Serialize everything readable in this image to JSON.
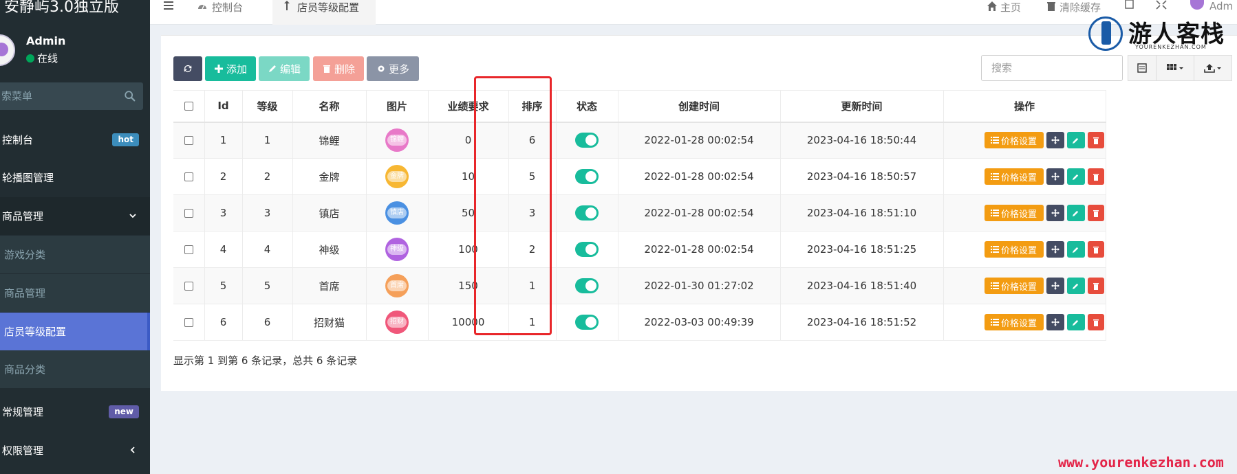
{
  "app": {
    "brand": "安静屿3.0独立版"
  },
  "user": {
    "name": "Admin",
    "status": "在线"
  },
  "sidebar": {
    "search_placeholder": "索菜单",
    "items": [
      {
        "label": "控制台",
        "badge": "hot"
      },
      {
        "label": "轮播图管理"
      },
      {
        "label": "商品管理"
      },
      {
        "label": "游戏分类"
      },
      {
        "label": "商品管理"
      },
      {
        "label": "店员等级配置"
      },
      {
        "label": "商品分类"
      },
      {
        "label": "常规管理",
        "badge": "new"
      },
      {
        "label": "权限管理"
      }
    ]
  },
  "header": {
    "tabs": [
      {
        "label": "控制台"
      },
      {
        "label": "店员等级配置"
      }
    ],
    "links": {
      "home": "主页",
      "clear_cache": "清除缓存",
      "admin": "Adm"
    }
  },
  "toolbar": {
    "add": "添加",
    "edit": "编辑",
    "delete": "删除",
    "more": "更多",
    "search_placeholder": "搜索"
  },
  "table": {
    "headers": [
      "Id",
      "等级",
      "名称",
      "图片",
      "业绩要求",
      "排序",
      "状态",
      "创建时间",
      "更新时间",
      "操作"
    ],
    "rows": [
      {
        "id": "1",
        "level": "1",
        "name": "锦鲤",
        "img_text": "锦鲤",
        "img_color": "#e879c8",
        "req": "0",
        "sort": "6",
        "created": "2022-01-28 00:02:54",
        "updated": "2023-04-16 18:50:44"
      },
      {
        "id": "2",
        "level": "2",
        "name": "金牌",
        "img_text": "金牌",
        "img_color": "#f7b733",
        "req": "10",
        "sort": "5",
        "created": "2022-01-28 00:02:54",
        "updated": "2023-04-16 18:50:57"
      },
      {
        "id": "3",
        "level": "3",
        "name": "镇店",
        "img_text": "镇店",
        "img_color": "#4a90e2",
        "req": "50",
        "sort": "3",
        "created": "2022-01-28 00:02:54",
        "updated": "2023-04-16 18:51:10"
      },
      {
        "id": "4",
        "level": "4",
        "name": "神级",
        "img_text": "神级",
        "img_color": "#b063e0",
        "req": "100",
        "sort": "2",
        "created": "2022-01-28 00:02:54",
        "updated": "2023-04-16 18:51:25"
      },
      {
        "id": "5",
        "level": "5",
        "name": "首席",
        "img_text": "首席",
        "img_color": "#f5a05a",
        "req": "150",
        "sort": "1",
        "created": "2022-01-30 01:27:02",
        "updated": "2023-04-16 18:51:40"
      },
      {
        "id": "6",
        "level": "6",
        "name": "招财猫",
        "img_text": "招财",
        "img_color": "#f0577a",
        "req": "10000",
        "sort": "1",
        "created": "2022-03-03 00:49:39",
        "updated": "2023-04-16 18:51:52"
      }
    ],
    "op_price_label": "价格设置"
  },
  "pager": {
    "summary": "显示第 1 到第 6 条记录，总共 6 条记录"
  },
  "watermark": {
    "title": "游人客栈",
    "sub": "YOURENKEZHAN.COM",
    "url": "www.yourenkezhan.com"
  },
  "colors": {
    "sidebar_bg": "#222d32",
    "active_menu": "#5572d8",
    "success": "#18bc9c",
    "warning": "#f39c12",
    "danger": "#e74c3c",
    "dark": "#444c63",
    "highlight": "#e8262a"
  }
}
